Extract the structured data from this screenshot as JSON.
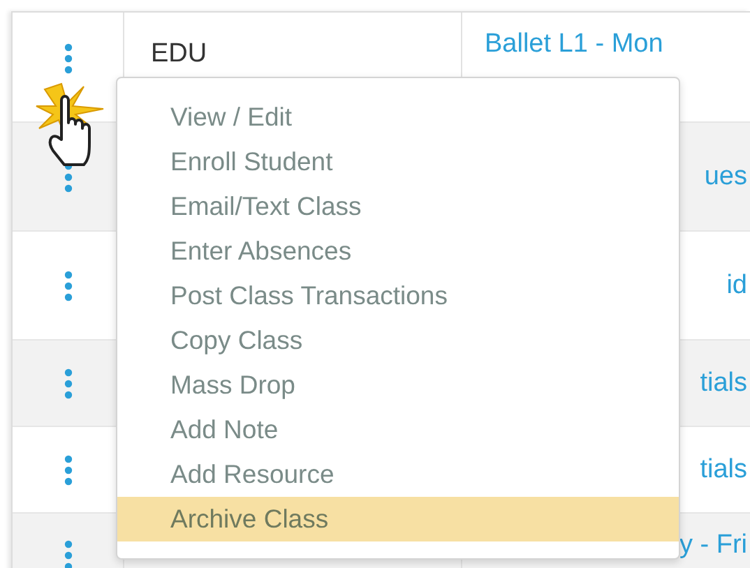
{
  "rows": [
    {
      "col_2": "EDU",
      "col_3": "Ballet L1 - Mon"
    },
    {
      "col_2": "",
      "col_3": "ues"
    },
    {
      "col_2": "",
      "col_3": "id"
    },
    {
      "col_2": "",
      "col_3": "tials"
    },
    {
      "col_2": "",
      "col_3": "tials"
    },
    {
      "col_2": "",
      "col_3": "y - Fri"
    }
  ],
  "menu": {
    "items": [
      {
        "label": "View / Edit",
        "highlighted": false
      },
      {
        "label": "Enroll Student",
        "highlighted": false
      },
      {
        "label": "Email/Text Class",
        "highlighted": false
      },
      {
        "label": "Enter Absences",
        "highlighted": false
      },
      {
        "label": "Post Class Transactions",
        "highlighted": false
      },
      {
        "label": "Copy Class",
        "highlighted": false
      },
      {
        "label": "Mass Drop",
        "highlighted": false
      },
      {
        "label": "Add Note",
        "highlighted": false
      },
      {
        "label": "Add Resource",
        "highlighted": false
      },
      {
        "label": "Archive Class",
        "highlighted": true
      }
    ]
  }
}
